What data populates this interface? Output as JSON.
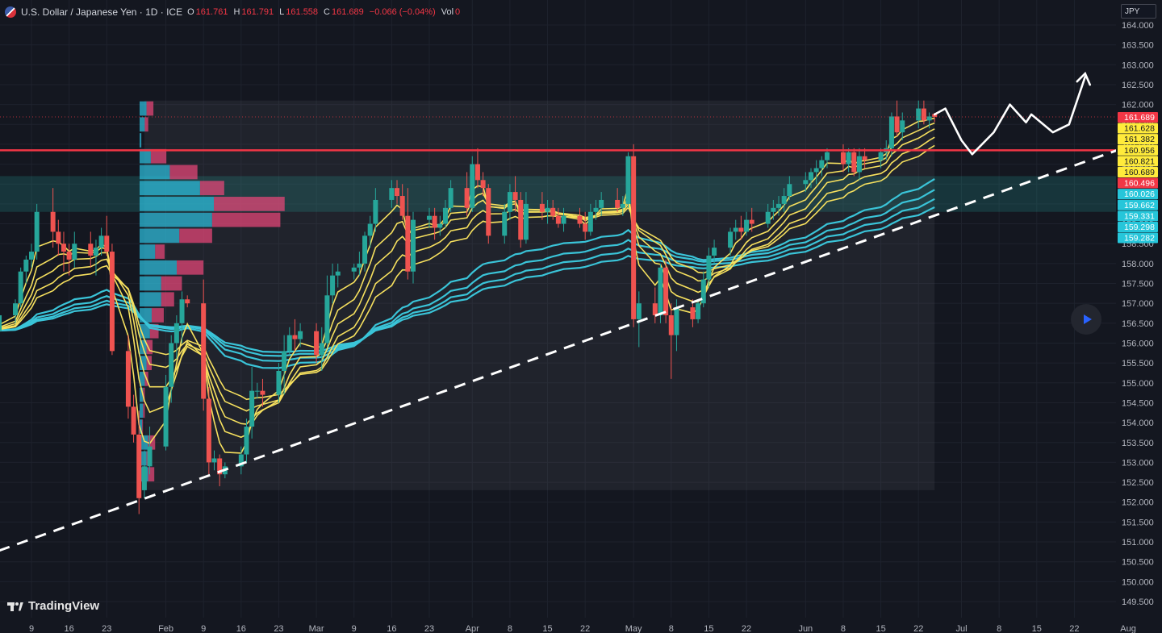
{
  "header": {
    "symbol": "U.S. Dollar / Japanese Yen · 1D · ICE",
    "open_label": "O",
    "open": "161.761",
    "high_label": "H",
    "high": "161.791",
    "low_label": "L",
    "low": "161.558",
    "close_label": "C",
    "close": "161.689",
    "change": "−0.066 (−0.04%)",
    "vol_label": "Vol",
    "vol": "0"
  },
  "currency_button": "JPY",
  "logo_text": "TradingView",
  "colors": {
    "background": "#141720",
    "up": "#26a69a",
    "down": "#ef5350",
    "ema_fast": "#f6e05e",
    "ema_slow": "#3ac4d8",
    "resistance": "#f23645",
    "trendline": "#ffffff"
  },
  "chart_data": {
    "type": "candlestick",
    "instrument": "USDJPY",
    "timeframe": "1D",
    "ylim": [
      149.25,
      164.1
    ],
    "y_ticks": [
      "164.000",
      "163.500",
      "163.000",
      "162.500",
      "162.000",
      "161.500",
      "161.000",
      "160.500",
      "160.000",
      "159.500",
      "159.000",
      "158.500",
      "158.000",
      "157.500",
      "157.000",
      "156.500",
      "156.000",
      "155.500",
      "155.000",
      "154.500",
      "154.000",
      "153.500",
      "153.000",
      "152.500",
      "152.000",
      "151.500",
      "151.000",
      "150.500",
      "150.000",
      "149.500"
    ],
    "x_ticks": [
      {
        "label": "9",
        "date": "2025-01-09"
      },
      {
        "label": "16",
        "date": "2025-01-16"
      },
      {
        "label": "23",
        "date": "2025-01-23"
      },
      {
        "label": "Feb",
        "date": "2025-02-03"
      },
      {
        "label": "9",
        "date": "2025-02-10"
      },
      {
        "label": "16",
        "date": "2025-02-17"
      },
      {
        "label": "23",
        "date": "2025-02-24"
      },
      {
        "label": "Mar",
        "date": "2025-03-03"
      },
      {
        "label": "9",
        "date": "2025-03-10"
      },
      {
        "label": "16",
        "date": "2025-03-17"
      },
      {
        "label": "23",
        "date": "2025-03-24"
      },
      {
        "label": "Apr",
        "date": "2025-04-01"
      },
      {
        "label": "8",
        "date": "2025-04-08"
      },
      {
        "label": "15",
        "date": "2025-04-15"
      },
      {
        "label": "22",
        "date": "2025-04-22"
      },
      {
        "label": "May",
        "date": "2025-05-01"
      },
      {
        "label": "8",
        "date": "2025-05-08"
      },
      {
        "label": "15",
        "date": "2025-05-15"
      },
      {
        "label": "22",
        "date": "2025-05-22"
      },
      {
        "label": "Jun",
        "date": "2025-06-02"
      },
      {
        "label": "8",
        "date": "2025-06-09"
      },
      {
        "label": "15",
        "date": "2025-06-16"
      },
      {
        "label": "22",
        "date": "2025-06-23"
      },
      {
        "label": "Jul",
        "date": "2025-07-01"
      },
      {
        "label": "8",
        "date": "2025-07-08"
      },
      {
        "label": "15",
        "date": "2025-07-15"
      },
      {
        "label": "22",
        "date": "2025-07-22"
      },
      {
        "label": "Aug",
        "date": "2025-08-01"
      }
    ],
    "last_price": 161.689,
    "price_labels": [
      {
        "value": 161.689,
        "text": "161.689",
        "color": "#f23645"
      },
      {
        "value": 161.628,
        "text": "161.628",
        "color": "#ffeb3b"
      },
      {
        "value": 161.382,
        "text": "161.382",
        "color": "#ffeb3b"
      },
      {
        "value": 160.956,
        "text": "160.956",
        "color": "#ffeb3b"
      },
      {
        "value": 160.821,
        "text": "160.821",
        "color": "#ffeb3b"
      },
      {
        "value": 160.689,
        "text": "160.689",
        "color": "#ffeb3b"
      },
      {
        "value": 160.496,
        "text": "160.496",
        "color": "#f23645"
      },
      {
        "value": 160.026,
        "text": "160.026",
        "color": "#26c6da"
      },
      {
        "value": 159.662,
        "text": "159.662",
        "color": "#26c6da"
      },
      {
        "value": 159.331,
        "text": "159.331",
        "color": "#26c6da"
      },
      {
        "value": 159.298,
        "text": "159.298",
        "color": "#26c6da"
      },
      {
        "value": 159.282,
        "text": "159.282",
        "color": "#26c6da"
      }
    ],
    "resistance_level": 160.85,
    "zone": {
      "top": 160.2,
      "bottom": 159.3
    },
    "range_box": {
      "from": "2025-01-30",
      "to": "2025-06-26",
      "top": 162.1,
      "bottom": 152.3
    },
    "trendline": [
      {
        "date": "2025-01-02",
        "value": 150.45
      },
      {
        "date": "2025-08-01",
        "value": 160.95
      }
    ],
    "projection": [
      {
        "date": "2025-06-26",
        "value": 161.75
      },
      {
        "date": "2025-06-28",
        "value": 161.9
      },
      {
        "date": "2025-07-01",
        "value": 161.1
      },
      {
        "date": "2025-07-03",
        "value": 160.75
      },
      {
        "date": "2025-07-07",
        "value": 161.3
      },
      {
        "date": "2025-07-10",
        "value": 162.0
      },
      {
        "date": "2025-07-13",
        "value": 161.55
      },
      {
        "date": "2025-07-14",
        "value": 161.75
      },
      {
        "date": "2025-07-18",
        "value": 161.3
      },
      {
        "date": "2025-07-21",
        "value": 161.5
      },
      {
        "date": "2025-07-24",
        "value": 162.7
      }
    ],
    "volume_profile": [
      {
        "price": 161.9,
        "up": 0.8,
        "down": 0.8
      },
      {
        "price": 161.5,
        "up": 0.6,
        "down": 0.4
      },
      {
        "price": 161.1,
        "up": 0.2,
        "down": 0
      },
      {
        "price": 160.7,
        "up": 1.3,
        "down": 1.8
      },
      {
        "price": 160.3,
        "up": 3.5,
        "down": 3.2
      },
      {
        "price": 159.9,
        "up": 7.0,
        "down": 2.8
      },
      {
        "price": 159.5,
        "up": 8.6,
        "down": 8.2
      },
      {
        "price": 159.1,
        "up": 8.4,
        "down": 7.9
      },
      {
        "price": 158.7,
        "up": 4.6,
        "down": 3.8
      },
      {
        "price": 158.3,
        "up": 1.8,
        "down": 1.1
      },
      {
        "price": 157.9,
        "up": 4.3,
        "down": 3.1
      },
      {
        "price": 157.5,
        "up": 2.5,
        "down": 2.4
      },
      {
        "price": 157.1,
        "up": 2.5,
        "down": 1.5
      },
      {
        "price": 156.7,
        "up": 1.4,
        "down": 1.4
      },
      {
        "price": 156.3,
        "up": 1.2,
        "down": 1.0
      },
      {
        "price": 155.9,
        "up": 0.8,
        "down": 0.7
      },
      {
        "price": 155.5,
        "up": 0.8,
        "down": 0.6
      },
      {
        "price": 155.1,
        "up": 0.6,
        "down": 0.4
      },
      {
        "price": 154.7,
        "up": 0.4,
        "down": 0.2
      },
      {
        "price": 154.3,
        "up": 0.4,
        "down": 0.2
      },
      {
        "price": 153.9,
        "up": 0.3,
        "down": 0.1
      },
      {
        "price": 153.5,
        "up": 1.0,
        "down": 0.8
      },
      {
        "price": 153.1,
        "up": 0.8,
        "down": 0.6
      },
      {
        "price": 152.7,
        "up": 1.0,
        "down": 0.7
      }
    ],
    "ohlc": [
      [
        "2025-01-02",
        156.35,
        156.55,
        156.05,
        156.3
      ],
      [
        "2025-01-03",
        156.3,
        156.8,
        156.2,
        156.7
      ],
      [
        "2025-01-06",
        156.7,
        157.1,
        156.5,
        157.0
      ],
      [
        "2025-01-07",
        157.0,
        157.9,
        156.9,
        157.8
      ],
      [
        "2025-01-08",
        157.8,
        158.2,
        157.5,
        158.1
      ],
      [
        "2025-01-09",
        158.1,
        158.5,
        157.9,
        158.3
      ],
      [
        "2025-01-10",
        158.3,
        159.5,
        158.1,
        159.3
      ],
      [
        "2025-01-13",
        159.3,
        159.9,
        158.4,
        158.8
      ],
      [
        "2025-01-14",
        158.8,
        159.1,
        158.2,
        158.5
      ],
      [
        "2025-01-15",
        158.5,
        158.8,
        157.8,
        158.3
      ],
      [
        "2025-01-16",
        158.3,
        158.5,
        157.7,
        158.1
      ],
      [
        "2025-01-17",
        158.1,
        158.8,
        157.9,
        158.5
      ],
      [
        "2025-01-20",
        158.5,
        158.8,
        157.9,
        158.2
      ],
      [
        "2025-01-21",
        158.2,
        158.6,
        157.7,
        158.4
      ],
      [
        "2025-01-22",
        158.4,
        158.9,
        158.2,
        158.7
      ],
      [
        "2025-01-23",
        158.7,
        159.2,
        158.2,
        158.3
      ],
      [
        "2025-01-24",
        158.3,
        158.5,
        155.7,
        155.8
      ],
      [
        "2025-01-27",
        155.8,
        156.2,
        154.1,
        154.4
      ],
      [
        "2025-01-28",
        154.4,
        154.7,
        153.5,
        153.7
      ],
      [
        "2025-01-29",
        153.7,
        154.3,
        151.7,
        152.1
      ],
      [
        "2025-01-30",
        152.3,
        153.3,
        152.1,
        152.9
      ],
      [
        "2025-01-31",
        152.9,
        153.9,
        152.7,
        153.4
      ],
      [
        "2025-02-03",
        153.4,
        155.2,
        153.3,
        154.9
      ],
      [
        "2025-02-04",
        154.9,
        156.2,
        154.5,
        156.0
      ],
      [
        "2025-02-05",
        156.0,
        156.7,
        155.6,
        156.5
      ],
      [
        "2025-02-06",
        156.5,
        157.3,
        156.0,
        157.1
      ],
      [
        "2025-02-07",
        157.1,
        157.2,
        156.9,
        157.0
      ],
      [
        "2025-02-10",
        157.0,
        157.6,
        154.3,
        154.6
      ],
      [
        "2025-02-11",
        154.6,
        154.9,
        152.7,
        153.0
      ],
      [
        "2025-02-12",
        153.0,
        153.3,
        152.8,
        153.1
      ],
      [
        "2025-02-13",
        153.1,
        153.2,
        152.4,
        152.7
      ],
      [
        "2025-02-14",
        152.7,
        153.0,
        152.6,
        152.9
      ],
      [
        "2025-02-17",
        152.9,
        153.4,
        152.7,
        153.2
      ],
      [
        "2025-02-18",
        153.2,
        154.1,
        153.0,
        153.9
      ],
      [
        "2025-02-19",
        153.9,
        155.4,
        153.6,
        154.8
      ],
      [
        "2025-02-20",
        154.8,
        155.0,
        154.6,
        154.8
      ],
      [
        "2025-02-21",
        154.8,
        155.1,
        154.4,
        154.7
      ],
      [
        "2025-02-24",
        154.7,
        155.5,
        154.5,
        155.3
      ],
      [
        "2025-02-25",
        155.3,
        156.2,
        154.7,
        155.8
      ],
      [
        "2025-02-26",
        155.8,
        156.4,
        155.7,
        156.2
      ],
      [
        "2025-02-27",
        156.2,
        156.6,
        155.8,
        156.1
      ],
      [
        "2025-02-28",
        156.1,
        156.5,
        155.9,
        156.3
      ],
      [
        "2025-03-03",
        156.3,
        156.5,
        155.5,
        155.7
      ],
      [
        "2025-03-04",
        155.7,
        156.4,
        155.3,
        156.0
      ],
      [
        "2025-03-05",
        156.0,
        157.7,
        155.9,
        157.2
      ],
      [
        "2025-03-06",
        157.2,
        158.0,
        157.0,
        157.7
      ],
      [
        "2025-03-07",
        157.7,
        158.0,
        157.4,
        157.8
      ],
      [
        "2025-03-10",
        157.8,
        158.0,
        157.6,
        157.9
      ],
      [
        "2025-03-11",
        157.9,
        158.3,
        157.7,
        158.0
      ],
      [
        "2025-03-12",
        158.0,
        158.8,
        157.8,
        158.7
      ],
      [
        "2025-03-13",
        158.7,
        159.2,
        158.4,
        159.0
      ],
      [
        "2025-03-14",
        159.0,
        159.9,
        158.8,
        159.6
      ],
      [
        "2025-03-17",
        159.6,
        160.1,
        159.4,
        159.9
      ],
      [
        "2025-03-18",
        159.9,
        160.1,
        159.5,
        159.7
      ],
      [
        "2025-03-19",
        159.7,
        160.0,
        159.1,
        159.2
      ],
      [
        "2025-03-20",
        159.2,
        159.9,
        157.6,
        157.8
      ],
      [
        "2025-03-21",
        157.8,
        159.3,
        157.5,
        159.1
      ],
      [
        "2025-03-24",
        159.1,
        159.4,
        158.9,
        159.2
      ],
      [
        "2025-03-25",
        159.2,
        159.4,
        158.6,
        158.9
      ],
      [
        "2025-03-26",
        158.9,
        159.2,
        158.7,
        159.0
      ],
      [
        "2025-03-27",
        159.0,
        159.6,
        158.9,
        159.4
      ],
      [
        "2025-03-28",
        159.4,
        160.1,
        159.3,
        159.9
      ],
      [
        "2025-03-31",
        159.9,
        160.3,
        159.2,
        159.4
      ],
      [
        "2025-04-01",
        159.4,
        160.7,
        159.3,
        160.5
      ],
      [
        "2025-04-02",
        160.5,
        160.9,
        159.9,
        160.1
      ],
      [
        "2025-04-03",
        160.1,
        160.3,
        159.7,
        159.9
      ],
      [
        "2025-04-04",
        159.9,
        160.0,
        158.5,
        158.7
      ],
      [
        "2025-04-07",
        158.7,
        159.5,
        158.5,
        159.3
      ],
      [
        "2025-04-08",
        159.3,
        160.0,
        159.1,
        159.8
      ],
      [
        "2025-04-09",
        159.8,
        160.2,
        159.3,
        159.6
      ],
      [
        "2025-04-10",
        159.6,
        159.8,
        158.4,
        158.6
      ],
      [
        "2025-04-11",
        158.6,
        159.8,
        158.5,
        159.5
      ],
      [
        "2025-04-14",
        159.5,
        159.8,
        159.1,
        159.3
      ],
      [
        "2025-04-15",
        159.3,
        159.6,
        159.0,
        159.4
      ],
      [
        "2025-04-16",
        159.4,
        159.6,
        159.1,
        159.2
      ],
      [
        "2025-04-17",
        159.2,
        159.4,
        158.9,
        159.0
      ],
      [
        "2025-04-18",
        159.0,
        159.4,
        158.8,
        159.2
      ],
      [
        "2025-04-21",
        159.2,
        159.4,
        158.9,
        159.0
      ],
      [
        "2025-04-22",
        159.0,
        159.3,
        158.6,
        158.8
      ],
      [
        "2025-04-23",
        158.8,
        159.5,
        158.7,
        159.3
      ],
      [
        "2025-04-24",
        159.3,
        159.6,
        159.1,
        159.4
      ],
      [
        "2025-04-25",
        159.4,
        159.8,
        159.2,
        159.6
      ],
      [
        "2025-04-28",
        159.6,
        159.9,
        159.3,
        159.4
      ],
      [
        "2025-04-29",
        159.4,
        159.7,
        159.2,
        159.5
      ],
      [
        "2025-04-30",
        159.5,
        160.8,
        159.4,
        160.7
      ],
      [
        "2025-05-01",
        160.7,
        161.0,
        156.4,
        156.6
      ],
      [
        "2025-05-02",
        156.6,
        157.3,
        155.9,
        157.0
      ],
      [
        "2025-05-05",
        157.0,
        157.4,
        156.5,
        156.7
      ],
      [
        "2025-05-06",
        156.7,
        158.0,
        156.5,
        157.9
      ],
      [
        "2025-05-07",
        157.9,
        158.1,
        156.5,
        156.7
      ],
      [
        "2025-05-08",
        156.7,
        157.0,
        155.1,
        156.2
      ],
      [
        "2025-05-09",
        156.2,
        157.1,
        155.8,
        156.9
      ],
      [
        "2025-05-12",
        156.9,
        157.1,
        156.4,
        156.6
      ],
      [
        "2025-05-13",
        156.6,
        157.1,
        156.5,
        157.0
      ],
      [
        "2025-05-14",
        157.0,
        157.8,
        156.9,
        157.6
      ],
      [
        "2025-05-15",
        157.6,
        158.4,
        157.4,
        158.2
      ],
      [
        "2025-05-16",
        158.2,
        158.6,
        158.0,
        158.4
      ],
      [
        "2025-05-19",
        158.4,
        158.9,
        158.2,
        158.8
      ],
      [
        "2025-05-20",
        158.8,
        159.1,
        158.6,
        158.9
      ],
      [
        "2025-05-21",
        158.9,
        159.2,
        158.6,
        158.8
      ],
      [
        "2025-05-22",
        158.8,
        159.3,
        158.7,
        159.1
      ],
      [
        "2025-05-23",
        159.1,
        159.4,
        158.8,
        159.0
      ],
      [
        "2025-05-26",
        159.0,
        159.5,
        158.9,
        159.3
      ],
      [
        "2025-05-27",
        159.3,
        159.6,
        159.1,
        159.4
      ],
      [
        "2025-05-28",
        159.4,
        159.7,
        159.2,
        159.5
      ],
      [
        "2025-05-29",
        159.5,
        159.9,
        159.3,
        159.7
      ],
      [
        "2025-05-30",
        159.7,
        160.2,
        159.6,
        160.0
      ],
      [
        "2025-06-02",
        160.0,
        160.3,
        159.8,
        160.1
      ],
      [
        "2025-06-03",
        160.1,
        160.4,
        159.9,
        160.3
      ],
      [
        "2025-06-04",
        160.3,
        160.6,
        160.0,
        160.4
      ],
      [
        "2025-06-05",
        160.4,
        160.7,
        160.2,
        160.6
      ],
      [
        "2025-06-06",
        160.6,
        160.9,
        160.4,
        160.8
      ],
      [
        "2025-06-09",
        160.8,
        161.0,
        160.3,
        160.5
      ],
      [
        "2025-06-10",
        160.5,
        160.9,
        160.3,
        160.8
      ],
      [
        "2025-06-11",
        160.8,
        160.9,
        160.2,
        160.3
      ],
      [
        "2025-06-12",
        160.3,
        160.9,
        160.1,
        160.7
      ],
      [
        "2025-06-13",
        160.7,
        160.9,
        160.4,
        160.6
      ],
      [
        "2025-06-16",
        160.6,
        160.9,
        160.4,
        160.8
      ],
      [
        "2025-06-17",
        160.8,
        161.1,
        160.6,
        160.9
      ],
      [
        "2025-06-18",
        160.9,
        161.8,
        160.7,
        161.7
      ],
      [
        "2025-06-19",
        161.7,
        162.1,
        161.2,
        161.3
      ],
      [
        "2025-06-20",
        161.3,
        161.8,
        161.1,
        161.6
      ],
      [
        "2025-06-23",
        161.6,
        162.1,
        161.4,
        161.9
      ],
      [
        "2025-06-24",
        161.9,
        162.1,
        161.5,
        161.6
      ],
      [
        "2025-06-25",
        161.6,
        161.8,
        161.4,
        161.7
      ],
      [
        "2025-06-26",
        161.761,
        161.791,
        161.558,
        161.689
      ]
    ]
  }
}
